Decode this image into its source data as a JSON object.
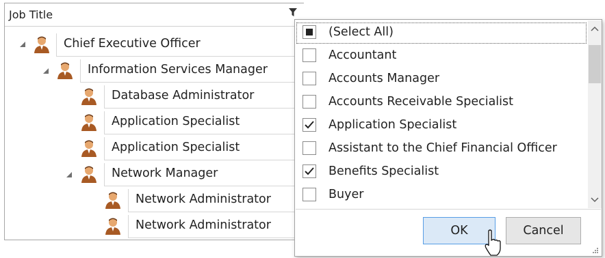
{
  "grid": {
    "column_header": "Job Title",
    "rows": [
      {
        "label": "Chief Executive Officer",
        "expanded": true
      },
      {
        "label": "Information Services Manager",
        "expanded": true
      },
      {
        "label": "Database Administrator"
      },
      {
        "label": "Application Specialist"
      },
      {
        "label": "Application Specialist"
      },
      {
        "label": "Network Manager",
        "expanded": true
      },
      {
        "label": "Network Administrator"
      },
      {
        "label": "Network Administrator"
      }
    ]
  },
  "filter_popup": {
    "items": [
      {
        "label": "(Select All)",
        "state": "indeterminate"
      },
      {
        "label": "Accountant",
        "state": "unchecked"
      },
      {
        "label": "Accounts Manager",
        "state": "unchecked"
      },
      {
        "label": "Accounts Receivable Specialist",
        "state": "unchecked"
      },
      {
        "label": "Application Specialist",
        "state": "checked"
      },
      {
        "label": "Assistant to the Chief Financial Officer",
        "state": "unchecked"
      },
      {
        "label": "Benefits Specialist",
        "state": "checked"
      },
      {
        "label": "Buyer",
        "state": "unchecked"
      }
    ],
    "ok_label": "OK",
    "cancel_label": "Cancel"
  },
  "colors": {
    "accent_border": "#569de5",
    "ok_fill": "#dbe9f7",
    "grid_line": "#d6d6d6"
  }
}
